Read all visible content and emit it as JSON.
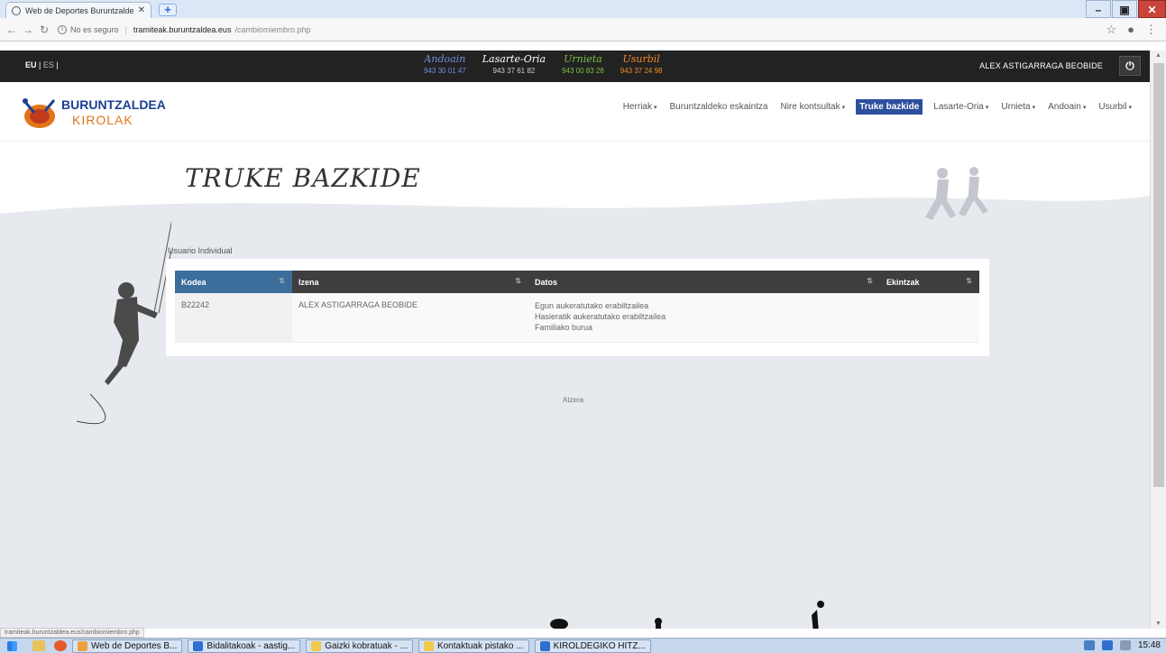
{
  "browser": {
    "tab_title": "Web de Deportes Buruntzaldea",
    "insecure_label": "No es seguro",
    "url_host": "tramiteak.buruntzaldea.eus",
    "url_path": "/cambiomiembro.php",
    "status_url": "tramiteak.buruntzaldea.eus/cambiomiembro.php"
  },
  "topbar": {
    "lang_eu": "EU",
    "lang_es": "ES",
    "towns": [
      {
        "name": "Andoain",
        "phone": "943 30 01 47",
        "color": "#6f8fe0"
      },
      {
        "name": "Lasarte-Oria",
        "phone": "943 37 61 82",
        "color": "#ffffff"
      },
      {
        "name": "Urnieta",
        "phone": "943 00 83 28",
        "color": "#7bc043"
      },
      {
        "name": "Usurbil",
        "phone": "943 37 24 98",
        "color": "#f08a24"
      }
    ],
    "user_name": "ALEX ASTIGARRAGA BEOBIDE",
    "logout_icon": "power-icon"
  },
  "header": {
    "brand_line1": "BURUNTZALDEA",
    "brand_line2": "KIROLAK",
    "menu": [
      {
        "label": "Herriak",
        "dropdown": true
      },
      {
        "label": "Buruntzaldeko eskaintza",
        "dropdown": false
      },
      {
        "label": "Nire kontsultak",
        "dropdown": true
      },
      {
        "label": "Truke bazkide",
        "dropdown": false,
        "active": true
      },
      {
        "label": "Lasarte-Oria",
        "dropdown": true
      },
      {
        "label": "Urnieta",
        "dropdown": true
      },
      {
        "label": "Andoain",
        "dropdown": true
      },
      {
        "label": "Usurbil",
        "dropdown": true
      }
    ]
  },
  "main": {
    "title": "TRUKE BAZKIDE",
    "section_label": "Usuario Individual",
    "table": {
      "headers": [
        "Kodea",
        "Izena",
        "Datos",
        "Ekintzak"
      ],
      "rows": [
        {
          "kodea": "B22242",
          "izena": "ALEX ASTIGARRAGA BEOBIDE",
          "datos": [
            "Egun aukeratutako erabiltzailea",
            "Hasieratik aukeratutako erabiltzailea",
            "Familiako burua"
          ],
          "ekintzak": ""
        }
      ]
    },
    "back_link": "Atzera"
  },
  "taskbar": {
    "items": [
      {
        "label": "Web de Deportes B...",
        "color": "#e9a23b"
      },
      {
        "label": "Bidalitakoak - aastig...",
        "color": "#2f6fd0"
      },
      {
        "label": "Gaizki kobratuak - ...",
        "color": "#f2c94c"
      },
      {
        "label": "Kontaktuak pistako ...",
        "color": "#f2c94c"
      },
      {
        "label": "KIROLDEGIKO HITZ...",
        "color": "#2f6fd0"
      }
    ],
    "clock": "15:48"
  }
}
